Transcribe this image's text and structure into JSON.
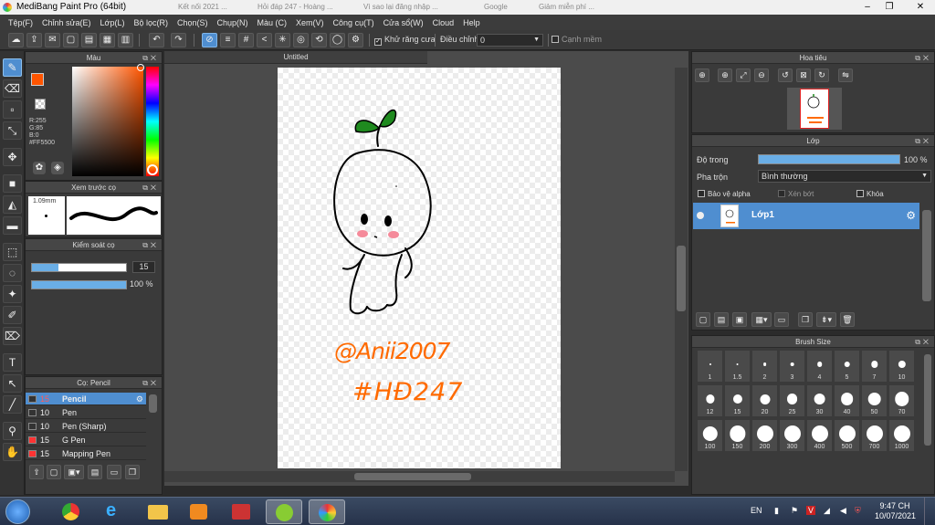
{
  "window": {
    "title": "MediBang Paint Pro (64bit)",
    "ghost_tabs": [
      "Kết nối 2021 ...",
      "Hỏi đáp 247 - Hoàng ...",
      "Vì sao lại đăng nhập ...",
      "Google",
      "Giảm miễn phí ..."
    ]
  },
  "menu": [
    "Tệp(F)",
    "Chỉnh sửa(E)",
    "Lớp(L)",
    "Bộ lọc(R)",
    "Chọn(S)",
    "Chụp(N)",
    "Màu (C)",
    "Xem(V)",
    "Công cụ(T)",
    "Cửa sổ(W)",
    "Cloud",
    "Help"
  ],
  "toolbar": {
    "antialias_label": "Khử răng cưa",
    "antialias_checked": true,
    "correction_label": "Điều chỉnh",
    "correction_value": "0",
    "smooth_label": "Cạnh mềm",
    "smooth_checked": false
  },
  "color_panel": {
    "title": "Màu",
    "primary_color": "#FF5500",
    "r": "R:255",
    "g": "G:85",
    "b": "B:0",
    "hex": "#FF5500"
  },
  "brush_preview": {
    "title": "Xem trước cọ",
    "size": "1.09mm"
  },
  "brush_control": {
    "title": "Kiểm soát cọ",
    "size_value": "15",
    "opacity_value": "100 %",
    "size_fraction": 0.28,
    "opacity_fraction": 1.0
  },
  "brush_list": {
    "title": "Cọ: Pencil",
    "items": [
      {
        "size": "15",
        "name": "Pencil",
        "color": "#ff3333",
        "selected": true
      },
      {
        "size": "10",
        "name": "Pen",
        "color": "#333333",
        "selected": false
      },
      {
        "size": "10",
        "name": "Pen (Sharp)",
        "color": "#333333",
        "selected": false
      },
      {
        "size": "15",
        "name": "G Pen",
        "color": "#ff3333",
        "selected": false
      },
      {
        "size": "15",
        "name": "Mapping Pen",
        "color": "#ff3333",
        "selected": false
      }
    ]
  },
  "document": {
    "tab_title": "Untitled",
    "signature_line1": "@Anii2007",
    "signature_line2": "#HĐ247",
    "ink_color": "#ff6a00"
  },
  "navigator": {
    "title": "Hoa tiêu"
  },
  "layer_panel": {
    "title": "Lớp",
    "opacity_label": "Độ trong",
    "opacity_value": "100 %",
    "opacity_fraction": 1.0,
    "blend_label": "Pha trộn",
    "blend_value": "Bình thường",
    "protect_alpha": "Bảo vệ alpha",
    "clipping": "Xén bớt",
    "lock": "Khóa",
    "layers": [
      {
        "name": "Lớp1"
      }
    ]
  },
  "brush_size": {
    "title": "Brush Size",
    "sizes": [
      "1",
      "1.5",
      "2",
      "3",
      "4",
      "5",
      "7",
      "10",
      "12",
      "15",
      "20",
      "25",
      "30",
      "40",
      "50",
      "70",
      "100",
      "150",
      "200",
      "300",
      "400",
      "500",
      "700",
      "1000"
    ]
  },
  "taskbar": {
    "language": "EN",
    "time": "9:47 CH",
    "date": "10/07/2021"
  },
  "colors": {
    "accent": "#4f8ed0",
    "panel_bg": "#3a3a3a",
    "canvas_bg": "#4b4b4b"
  }
}
